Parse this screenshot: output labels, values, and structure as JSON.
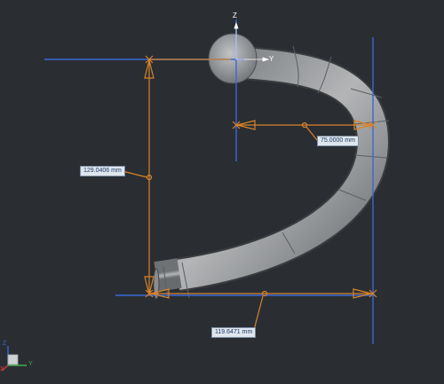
{
  "viewport": {
    "axis_labels": {
      "z": "Z",
      "y": "Y"
    },
    "dimensions": {
      "vertical": "129.0406 mm",
      "horizontal_short": "75.0000 mm",
      "horizontal_long": "119.6471 mm"
    },
    "triad_labels": {
      "z": "Z",
      "x": "X",
      "y": "Y"
    },
    "colors": {
      "background": "#2a2e33",
      "dimension_line": "#d8832a",
      "axis_line": "#3a68d8",
      "tube": "#9a9c9e"
    }
  }
}
